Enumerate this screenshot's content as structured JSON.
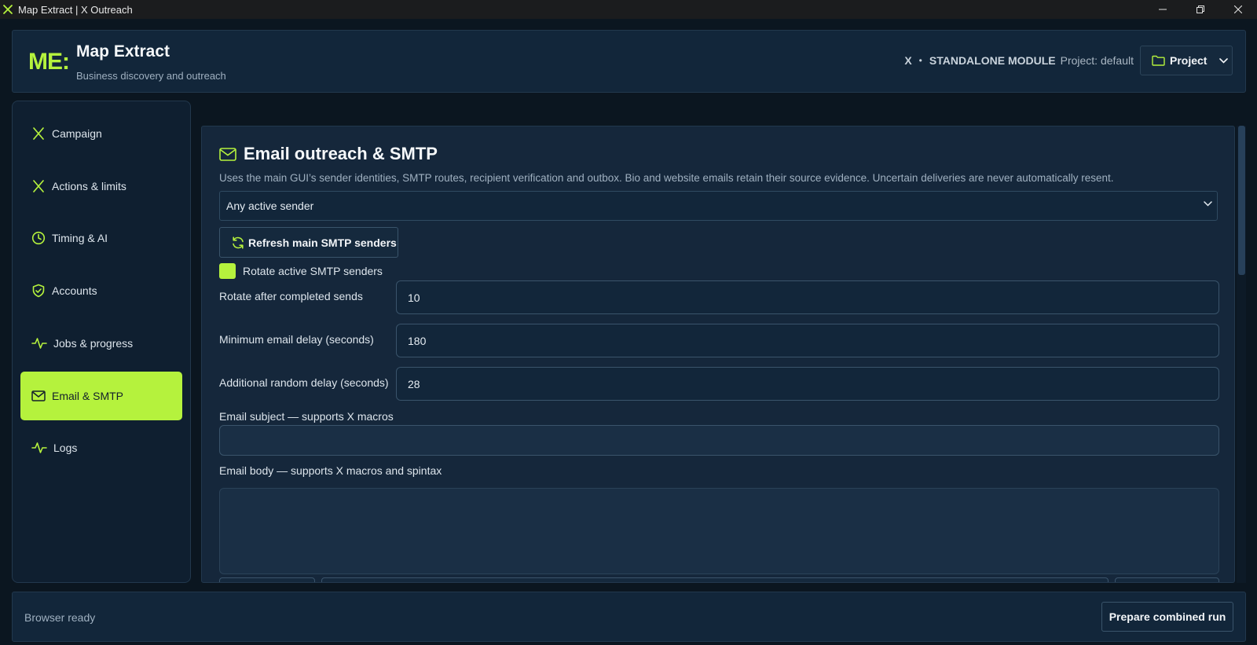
{
  "window": {
    "title": "Map Extract | X Outreach",
    "controls": [
      "minimize",
      "restore",
      "close"
    ]
  },
  "header": {
    "logo": "ME:",
    "title": "Map Extract",
    "subtitle": "Business discovery and outreach",
    "module_x": "X",
    "module_sep": "•",
    "module_label": "STANDALONE MODULE",
    "project_label": "Project: default",
    "project_button": "Project"
  },
  "sidebar": {
    "items": [
      {
        "label": "Campaign",
        "icon": "x-icon",
        "active": false
      },
      {
        "label": "Actions & limits",
        "icon": "x-icon",
        "active": false
      },
      {
        "label": "Timing & AI",
        "icon": "clock-icon",
        "active": false
      },
      {
        "label": "Accounts",
        "icon": "shield-check-icon",
        "active": false
      },
      {
        "label": "Jobs & progress",
        "icon": "activity-icon",
        "active": false
      },
      {
        "label": "Email & SMTP",
        "icon": "mail-icon",
        "active": true
      },
      {
        "label": "Logs",
        "icon": "activity-icon",
        "active": false
      }
    ]
  },
  "email": {
    "title": "Email outreach & SMTP",
    "description": "Uses the main GUI’s sender identities, SMTP routes, recipient verification and outbox. Bio and website emails retain their source evidence. Uncertain deliveries are never automatically resent.",
    "sender_select": "Any active sender",
    "refresh_button": "Refresh main SMTP senders",
    "rotate_checkbox": "Rotate active SMTP senders",
    "rotate_checked": true,
    "rotate_after_label": "Rotate after completed sends",
    "rotate_after_value": "10",
    "min_delay_label": "Minimum email delay (seconds)",
    "min_delay_value": "180",
    "random_delay_label": "Additional random delay (seconds)",
    "random_delay_value": "28",
    "subject_label": "Email subject — supports X macros",
    "subject_value": "",
    "body_label": "Email body — supports X macros and spintax",
    "body_value": ""
  },
  "footer": {
    "status": "Browser ready",
    "prepare_button": "Prepare combined run"
  },
  "colors": {
    "accent": "#b5f23d",
    "background": "#0b1620",
    "panel": "#15273b",
    "border": "#3a546b"
  }
}
